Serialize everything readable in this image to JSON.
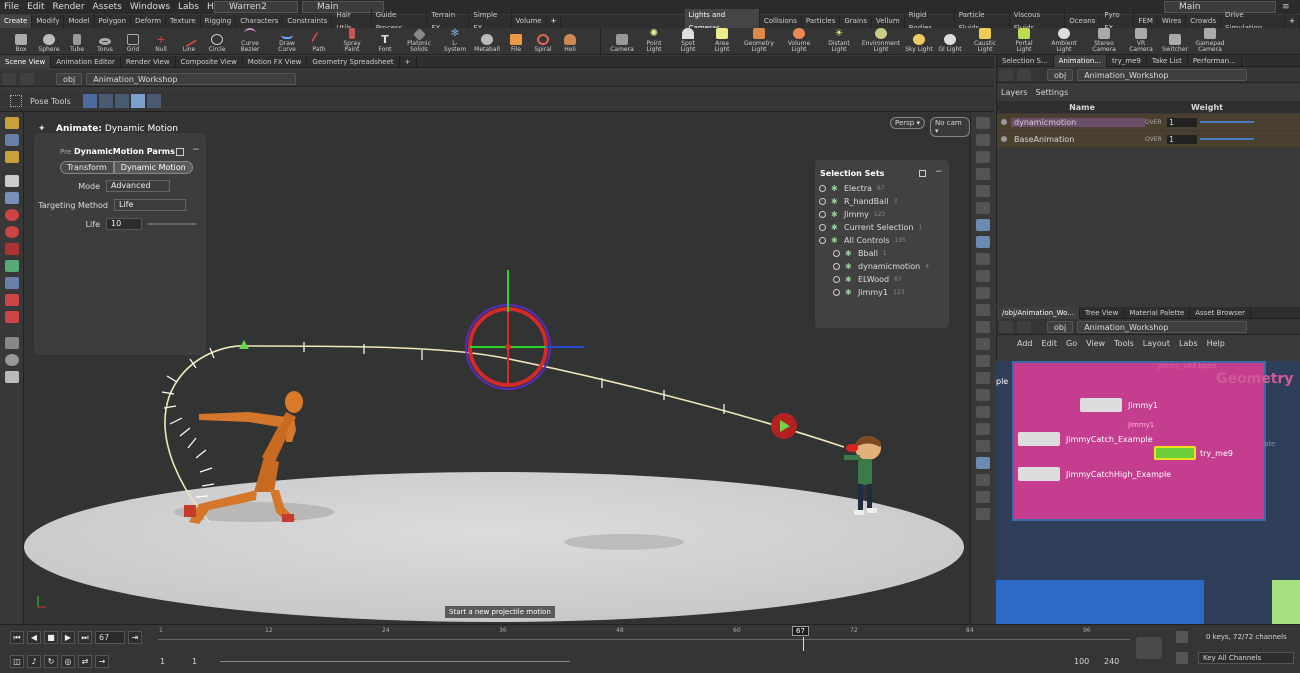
{
  "menu": [
    "File",
    "Edit",
    "Render",
    "Assets",
    "Windows",
    "Labs",
    "Help"
  ],
  "desktop": "Warren2",
  "main": "Main",
  "main_right": "Main",
  "shelf_tabs": [
    "Create",
    "Modify",
    "Model",
    "Polygon",
    "Deform",
    "Texture",
    "Rigging",
    "Characters",
    "Constraints",
    "Hair Utils",
    "Guide Process",
    "Terrain FX",
    "Simple FX",
    "Volume"
  ],
  "shelf_tabs_right": [
    "Lights and Cameras",
    "Collisions",
    "Particles",
    "Grains",
    "Vellum",
    "Rigid Bodies",
    "Particle Fluids",
    "Viscous Fluids",
    "Oceans",
    "Pyro FX",
    "FEM",
    "Wires",
    "Crowds",
    "Drive Simulation"
  ],
  "tools_left": [
    "Box",
    "Sphere",
    "Tube",
    "Torus",
    "Grid",
    "Null",
    "Line",
    "Circle",
    "Curve Bezier",
    "Draw Curve",
    "Path",
    "Spray Paint",
    "Font",
    "Platonic Solids",
    "L-System",
    "Metaball",
    "File",
    "Spiral",
    "Heli"
  ],
  "tools_right": [
    "Camera",
    "Point Light",
    "Spot Light",
    "Area Light",
    "Geometry Light",
    "Volume Light",
    "Distant Light",
    "Environment Light",
    "Sky Light",
    "GI Light",
    "Caustic Light",
    "Portal Light",
    "Ambient Light",
    "Stereo Camera",
    "VR Camera",
    "Switcher",
    "Gamepad Camera"
  ],
  "pane_tabs": [
    "Scene View",
    "Animation Editor",
    "Render View",
    "Composite View",
    "Motion FX View",
    "Geometry Spreadsheet"
  ],
  "path": {
    "root": "obj",
    "node": "Animation_Workshop"
  },
  "pose_tools": "Pose Tools",
  "viewport": {
    "animate_label": "Animate:",
    "animate_value": "Dynamic Motion",
    "persp": "Persp ▾",
    "cam": "No cam ▾",
    "tooltip": "Start a new projectile motion"
  },
  "params": {
    "title": "DynamicMotion Parms",
    "preset": "Pre",
    "tabs": [
      "Transform",
      "Dynamic Motion"
    ],
    "mode_label": "Mode",
    "mode_value": "Advanced",
    "target_label": "Targeting Method",
    "target_value": "Life",
    "life_label": "Life",
    "life_value": "10"
  },
  "selection_sets": {
    "title": "Selection Sets",
    "items": [
      {
        "name": "Electra",
        "count": "67"
      },
      {
        "name": "R_handBall",
        "count": "3"
      },
      {
        "name": "Jimmy",
        "count": "123"
      },
      {
        "name": "Current Selection",
        "count": "1"
      },
      {
        "name": "All Controls",
        "count": "195"
      },
      {
        "name": "Bball",
        "count": "1"
      },
      {
        "name": "dynamicmotion",
        "count": "4"
      },
      {
        "name": "ELWood",
        "count": "67"
      },
      {
        "name": "Jimmy1",
        "count": "123"
      }
    ]
  },
  "right_top": {
    "tabs": [
      "Selection S...",
      "Animation...",
      "try_me9",
      "Take List",
      "Performan..."
    ],
    "subtabs": [
      "Layers",
      "Settings"
    ],
    "cols": [
      "Name",
      "Weight"
    ],
    "layers": [
      {
        "name": "dynamicmotion",
        "mode": "OVER",
        "weight": "1"
      },
      {
        "name": "BaseAnimation",
        "mode": "OVER",
        "weight": "1"
      }
    ]
  },
  "right_bottom": {
    "tabs": [
      "/obj/Animation_Wo...",
      "Tree View",
      "Material Palette",
      "Asset Browser"
    ],
    "menu": [
      "Add",
      "Edit",
      "Go",
      "View",
      "Tools",
      "Layout",
      "Labs",
      "Help"
    ],
    "geometry_label": "Geometry",
    "nodes": [
      "Jimmy1",
      "JimmyCatch_Example",
      "try_me9",
      "JimmyCatchHigh_Example"
    ],
    "small": [
      "Jimmy_v02.bgeo",
      "Jimmy1",
      "ple",
      "ate"
    ]
  },
  "timeline": {
    "frame": "67",
    "current": "67",
    "ticks": [
      "1",
      "12",
      "24",
      "36",
      "48",
      "60",
      "72",
      "84",
      "96"
    ],
    "start": "1",
    "start2": "1",
    "end": "100",
    "end2": "240",
    "keys": "0 keys, 72/72 channels",
    "key_all": "Key All Channels"
  },
  "colors": {
    "accent": "#e8c23a",
    "node_pink": "#c43d8e",
    "node_blue": "#3b6aa8"
  }
}
